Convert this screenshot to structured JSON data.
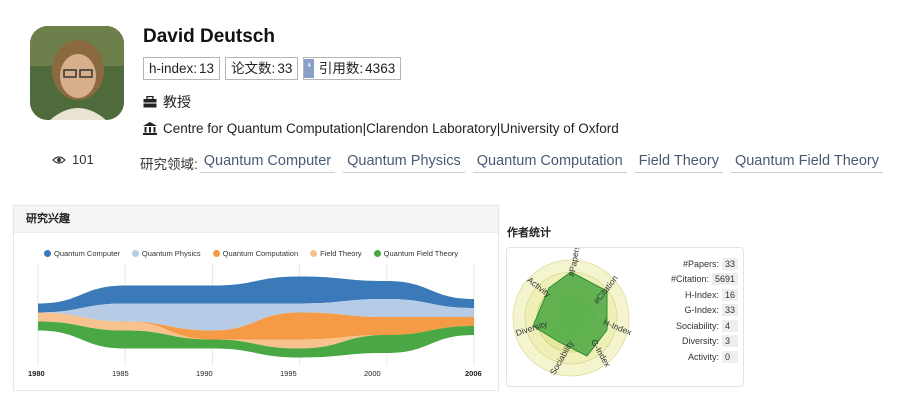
{
  "profile": {
    "name": "David Deutsch",
    "views": "101",
    "badges": [
      {
        "key": "h-index",
        "label": "h-index:",
        "value": "13"
      },
      {
        "key": "papers",
        "label": "论文数:",
        "value": "33"
      },
      {
        "key": "citations",
        "label": "引用数:",
        "value": "4363"
      }
    ],
    "title": "教授",
    "organization": "Centre for Quantum Computation|Clarendon Laboratory|University of Oxford",
    "interests_label": "研究领域:",
    "interests": [
      "Quantum Computer",
      "Quantum Physics",
      "Quantum Computation",
      "Field Theory",
      "Quantum Field Theory"
    ]
  },
  "research_panel": {
    "title": "研究兴趣",
    "legend": [
      {
        "name": "Quantum Computer",
        "color": "#3a7ab8"
      },
      {
        "name": "Quantum Physics",
        "color": "#b6cbe6"
      },
      {
        "name": "Quantum Computation",
        "color": "#f59a45"
      },
      {
        "name": "Field Theory",
        "color": "#f8c28e"
      },
      {
        "name": "Quantum Field Theory",
        "color": "#4aa844"
      }
    ],
    "x_ticks": [
      "1980",
      "1985",
      "1990",
      "1995",
      "2000",
      "2006"
    ]
  },
  "stats_panel": {
    "title": "作者统计",
    "radar_labels": [
      "#Papers",
      "#Citation",
      "H-Index",
      "G-Index",
      "Sociability",
      "Diversity",
      "Activity"
    ],
    "rows": [
      {
        "label": "#Papers:",
        "value": "33"
      },
      {
        "label": "#Citation:",
        "value": "5691"
      },
      {
        "label": "H-Index:",
        "value": "16"
      },
      {
        "label": "G-Index:",
        "value": "33"
      },
      {
        "label": "Sociability:",
        "value": "4"
      },
      {
        "label": "Diversity:",
        "value": "3"
      },
      {
        "label": "Activity:",
        "value": "0"
      }
    ]
  },
  "chart_data": {
    "type": "area",
    "title": "",
    "x": [
      "1980",
      "1985",
      "1990",
      "1995",
      "2000",
      "2006"
    ],
    "series": [
      {
        "name": "Quantum Computer",
        "values": [
          1,
          2,
          2,
          3,
          2,
          1
        ]
      },
      {
        "name": "Quantum Physics",
        "values": [
          0,
          2,
          3,
          1,
          2,
          1
        ]
      },
      {
        "name": "Quantum Computation",
        "values": [
          0,
          0,
          1,
          3,
          2,
          1
        ]
      },
      {
        "name": "Field Theory",
        "values": [
          1,
          1,
          0,
          1,
          0,
          0
        ]
      },
      {
        "name": "Quantum Field Theory",
        "values": [
          1,
          2,
          1,
          1,
          2,
          1
        ]
      }
    ]
  }
}
